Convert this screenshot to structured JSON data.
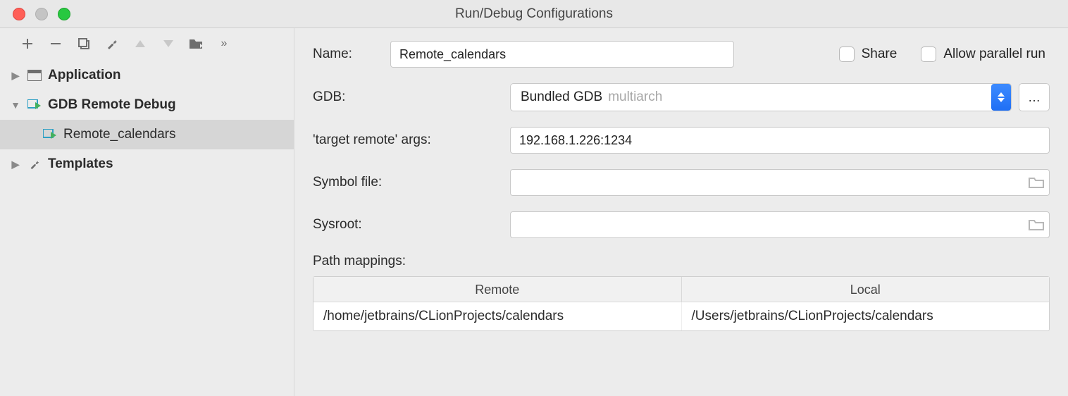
{
  "window": {
    "title": "Run/Debug Configurations"
  },
  "toolbar_icons": {
    "add": "add-icon",
    "remove": "remove-icon",
    "copy": "copy-icon",
    "save": "wrench-icon",
    "up": "up-icon",
    "down": "down-icon",
    "folder": "folder-move-icon",
    "more": "more-icon"
  },
  "tree": {
    "items": [
      {
        "label": "Application",
        "kind": "group"
      },
      {
        "label": "GDB Remote Debug",
        "kind": "group"
      },
      {
        "label": "Remote_calendars",
        "kind": "config"
      },
      {
        "label": "Templates",
        "kind": "group"
      }
    ]
  },
  "form": {
    "name_label": "Name:",
    "name_value": "Remote_calendars",
    "share_label": "Share",
    "parallel_label": "Allow parallel run",
    "gdb_label": "GDB:",
    "gdb_value": "Bundled GDB",
    "gdb_hint": "multiarch",
    "target_args_label": "'target remote' args:",
    "target_args_value": "192.168.1.226:1234",
    "symbol_label": "Symbol file:",
    "symbol_value": "",
    "sysroot_label": "Sysroot:",
    "sysroot_value": "",
    "mappings_label": "Path mappings:",
    "mappings": {
      "headers": {
        "remote": "Remote",
        "local": "Local"
      },
      "rows": [
        {
          "remote": "/home/jetbrains/CLionProjects/calendars",
          "local": "/Users/jetbrains/CLionProjects/calendars"
        }
      ]
    }
  }
}
